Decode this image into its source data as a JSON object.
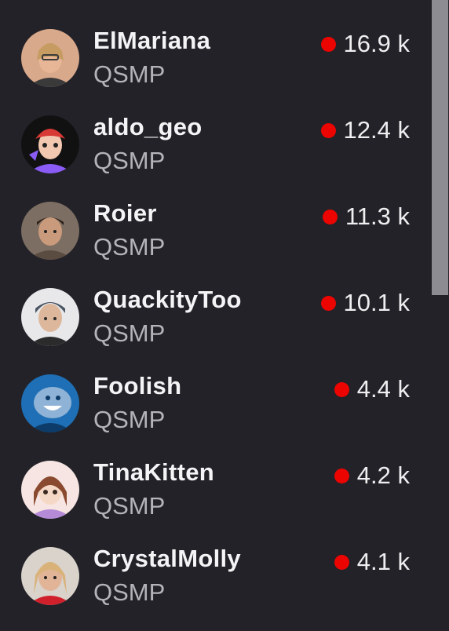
{
  "channels": [
    {
      "name": "ElMariana",
      "category": "QSMP",
      "viewers": "16.9 k",
      "avatar_icon": "avatar-elmariana-icon",
      "colors": {
        "bg": "#d9a98b",
        "skin": "#e7b697",
        "hair": "#c79c63",
        "accent": "#3a3a3a"
      }
    },
    {
      "name": "aldo_geo",
      "category": "QSMP",
      "viewers": "12.4 k",
      "avatar_icon": "avatar-aldo-geo-icon",
      "colors": {
        "bg": "#111111",
        "skin": "#f2c9b0",
        "hair": "#d83a35",
        "accent": "#8a5cf5"
      }
    },
    {
      "name": "Roier",
      "category": "QSMP",
      "viewers": "11.3 k",
      "avatar_icon": "avatar-roier-icon",
      "colors": {
        "bg": "#7c6e62",
        "skin": "#c99a7b",
        "hair": "#2a1d16",
        "accent": "#5b4c41"
      }
    },
    {
      "name": "QuackityToo",
      "category": "QSMP",
      "viewers": "10.1 k",
      "avatar_icon": "avatar-quackitytoo-icon",
      "colors": {
        "bg": "#e8e8ea",
        "skin": "#dcb79c",
        "hair": "#4a5563",
        "accent": "#2b2b2b"
      }
    },
    {
      "name": "Foolish",
      "category": "QSMP",
      "viewers": "4.4 k",
      "avatar_icon": "avatar-foolish-icon",
      "colors": {
        "bg": "#1e6fb5",
        "skin": "#8fb3d6",
        "hair": "#ffffff",
        "accent": "#0d3c6a"
      }
    },
    {
      "name": "TinaKitten",
      "category": "QSMP",
      "viewers": "4.2 k",
      "avatar_icon": "avatar-tinakitten-icon",
      "colors": {
        "bg": "#f6e5e2",
        "skin": "#f6d8c6",
        "hair": "#8a4a2f",
        "accent": "#b58bd8"
      }
    },
    {
      "name": "CrystalMolly",
      "category": "QSMP",
      "viewers": "4.1 k",
      "avatar_icon": "avatar-crystalmolly-icon",
      "colors": {
        "bg": "#d9d3cc",
        "skin": "#e2b497",
        "hair": "#d9b27a",
        "accent": "#d0202b"
      }
    }
  ],
  "live_indicator_color": "#eb0400",
  "scrollbar": {
    "thumb_color": "#8c8c92"
  }
}
